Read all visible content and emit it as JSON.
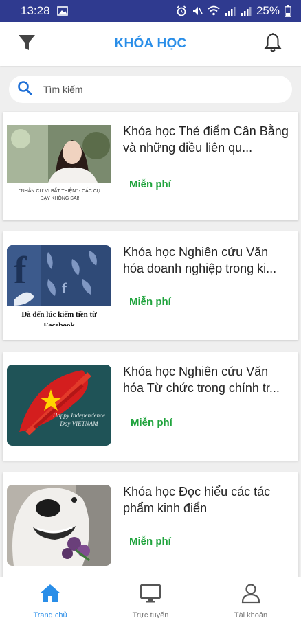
{
  "status_bar": {
    "time": "13:28",
    "battery": "25%"
  },
  "header": {
    "title": "KHÓA HỌC"
  },
  "search": {
    "placeholder": "Tìm kiếm"
  },
  "courses": [
    {
      "title": "Khóa học Thẻ điểm Cân Bằng và những điều liên qu...",
      "price": "Miễn phí",
      "thumb_caption": "\"NHÂN CƯ VI BẤT THIỆN\" - CÁC CỤ DẠY KHÔNG SAI!"
    },
    {
      "title": "Khóa học Nghiên cứu Văn hóa doanh nghiệp trong ki...",
      "price": "Miễn phí",
      "thumb_caption": "Đã đến lúc kiếm tiền từ Facebook"
    },
    {
      "title": "Khóa học Nghiên cứu Văn hóa Từ chức trong chính tr...",
      "price": "Miễn phí",
      "thumb_caption": "Happy Independence Day VIETNAM"
    },
    {
      "title": "Khóa học Đọc hiểu các tác phẩm kinh điển",
      "price": "Miễn phí",
      "thumb_caption": ""
    }
  ],
  "bottom_nav": [
    {
      "label": "Trang chủ",
      "icon": "home-icon",
      "active": true
    },
    {
      "label": "Trực tuyến",
      "icon": "monitor-icon",
      "active": false
    },
    {
      "label": "Tài khoản",
      "icon": "user-icon",
      "active": false
    }
  ],
  "colors": {
    "accent": "#2a8ee8",
    "status_bar": "#2f3a8f",
    "price": "#1fa33c"
  }
}
